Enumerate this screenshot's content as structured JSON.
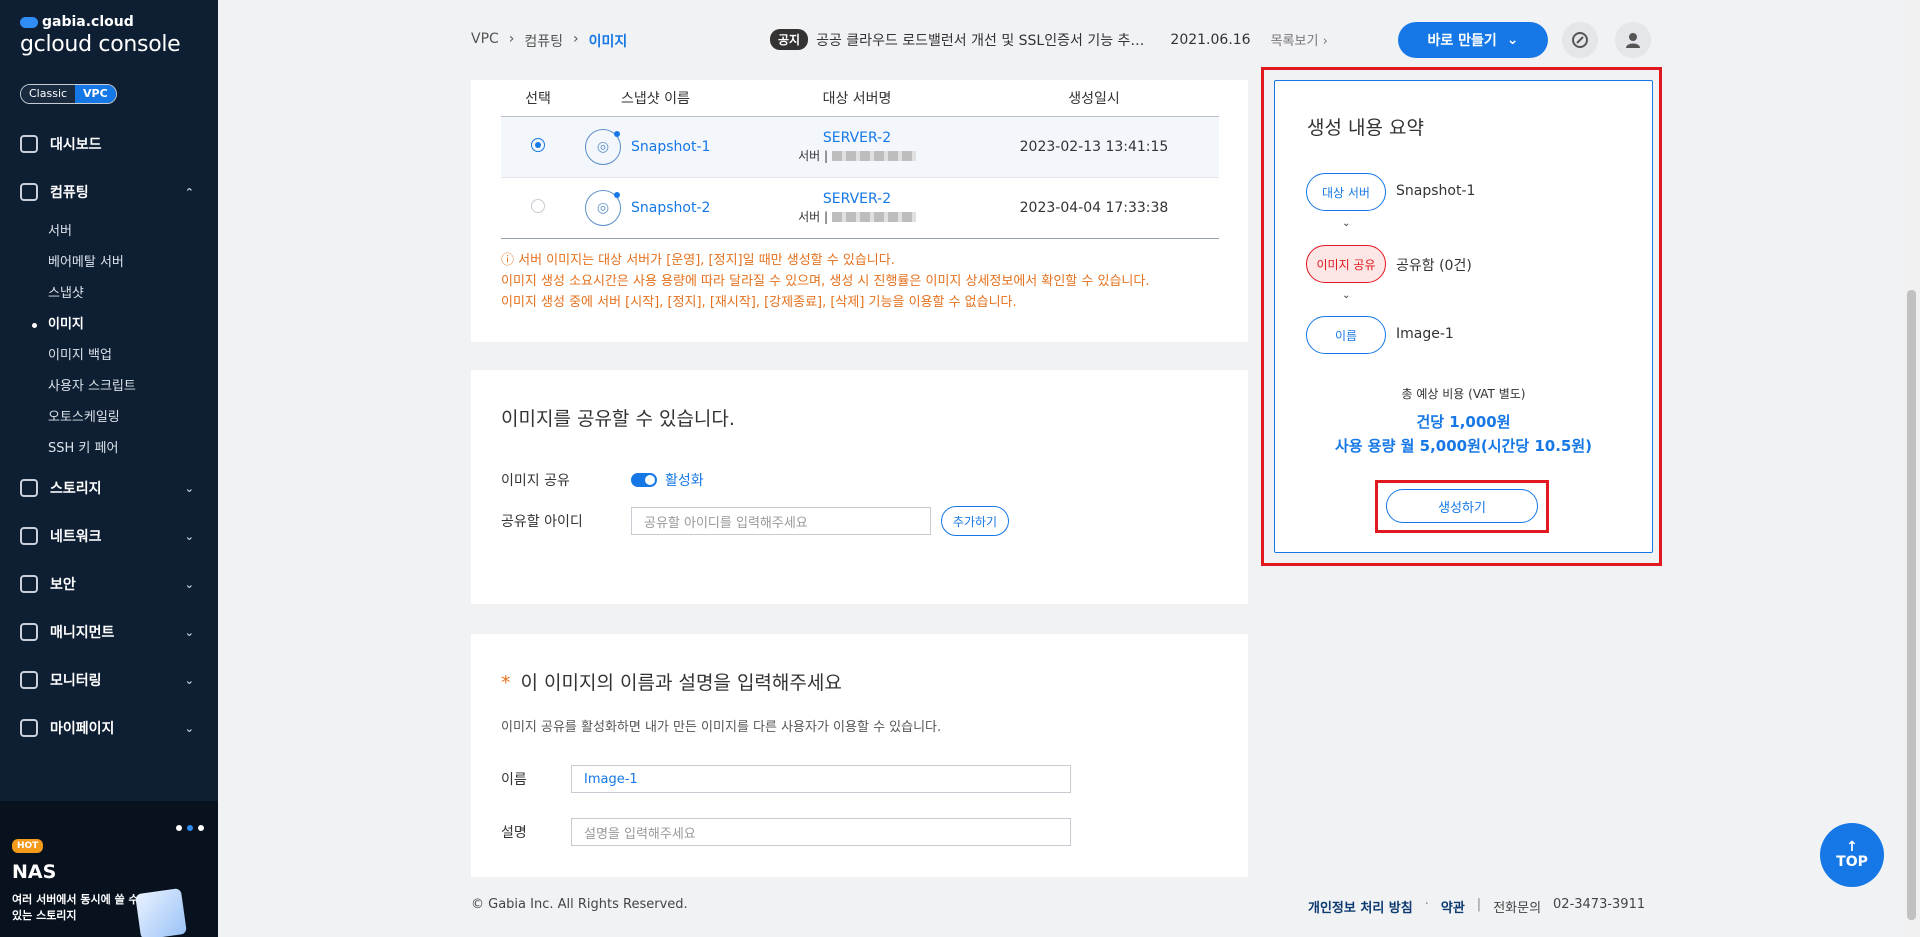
{
  "sidebar": {
    "brand": "gabia.cloud",
    "title": "gcloud console",
    "switch": {
      "classic": "Classic",
      "vpc": "VPC"
    },
    "items": [
      {
        "label": "대시보드",
        "icon": "gauge-icon"
      },
      {
        "label": "컴퓨팅",
        "icon": "chip-icon",
        "caret": "⌃"
      },
      {
        "label": "스토리지",
        "icon": "storage-icon",
        "caret": "⌄"
      },
      {
        "label": "네트워크",
        "icon": "network-icon",
        "caret": "⌄"
      },
      {
        "label": "보안",
        "icon": "shield-icon",
        "caret": "⌄"
      },
      {
        "label": "매니지먼트",
        "icon": "management-icon",
        "caret": "⌄"
      },
      {
        "label": "모니터링",
        "icon": "monitor-icon",
        "caret": "⌄"
      },
      {
        "label": "마이페이지",
        "icon": "user-icon",
        "caret": "⌄"
      }
    ],
    "sub_items": [
      "서버",
      "베어메탈 서버",
      "스냅샷",
      "이미지",
      "이미지 백업",
      "사용자 스크립트",
      "오토스케일링",
      "SSH 키 페어"
    ],
    "banner": {
      "hot": "HOT",
      "name": "NAS",
      "desc": "여러 서버에서 동시에 쓸 수 있는 스토리지"
    }
  },
  "topbar": {
    "breadcrumb": [
      "VPC",
      "›",
      "컴퓨팅",
      "›",
      "이미지"
    ],
    "notice_tag": "공지",
    "notice_text": "공공 클라우드 로드밸런서 개선 및 SSL인증서 기능 추…",
    "notice_date": "2021.06.16",
    "notice_more": "목록보기 ›",
    "quick_button": "바로 만들기",
    "quick_caret": "⌄"
  },
  "snapshot_table": {
    "headers": [
      "선택",
      "스냅샷 이름",
      "대상 서버명",
      "생성일시"
    ],
    "rows": [
      {
        "name": "Snapshot-1",
        "server": "SERVER-2",
        "server_sub": "서버 |",
        "created": "2023-02-13 13:41:15",
        "selected": true
      },
      {
        "name": "Snapshot-2",
        "server": "SERVER-2",
        "server_sub": "서버 |",
        "created": "2023-04-04 17:33:38",
        "selected": false
      }
    ],
    "warnings": [
      "ⓘ 서버 이미지는 대상 서버가 [운영], [정지]일 때만 생성할 수 있습니다.",
      "이미지 생성 소요시간은 사용 용량에 따라 달라질 수 있으며, 생성 시 진행률은 이미지 상세정보에서 확인할 수 있습니다.",
      "이미지 생성 중에 서버 [시작], [정지], [재시작], [강제종료], [삭제] 기능을 이용할 수 없습니다."
    ]
  },
  "share": {
    "title": "이미지를 공유할 수 있습니다.",
    "toggle_label": "이미지 공유",
    "toggle_state": "활성화",
    "id_label": "공유할 아이디",
    "id_placeholder": "공유할 아이디를 입력해주세요",
    "add_button": "추가하기"
  },
  "name_form": {
    "required_mark": "*",
    "title": "이 이미지의 이름과 설명을 입력해주세요",
    "desc": "이미지 공유를 활성화하면 내가 만든 이미지를 다른 사용자가 이용할 수 있습니다.",
    "name_label": "이름",
    "name_value": "Image-1",
    "desc_label": "설명",
    "desc_placeholder": "설명을 입력해주세요"
  },
  "summary": {
    "title": "생성 내용 요약",
    "steps": [
      {
        "pill": "대상 서버",
        "value": "Snapshot-1"
      },
      {
        "pill": "이미지 공유",
        "value": "공유함 (0건)"
      },
      {
        "pill": "이름",
        "value": "Image-1"
      }
    ],
    "cost_label": "총 예상 비용 (VAT 별도)",
    "cost_line1": "건당 1,000원",
    "cost_line2": "사용 용량 월 5,000원(시간당 10.5원)",
    "create_button": "생성하기"
  },
  "footer": {
    "copyright": "© Gabia Inc. All Rights Reserved.",
    "privacy": "개인정보 처리 방침",
    "dot": "·",
    "terms": "약관",
    "bar": "|",
    "phone_label": "전화문의",
    "phone": "02-3473-3911"
  },
  "top_button": {
    "arrow": "↑",
    "label": "TOP"
  },
  "colors": {
    "accent": "#1678e6",
    "sidebar": "#0e1f33",
    "warning": "#e5711e",
    "highlight": "#e0181f"
  }
}
